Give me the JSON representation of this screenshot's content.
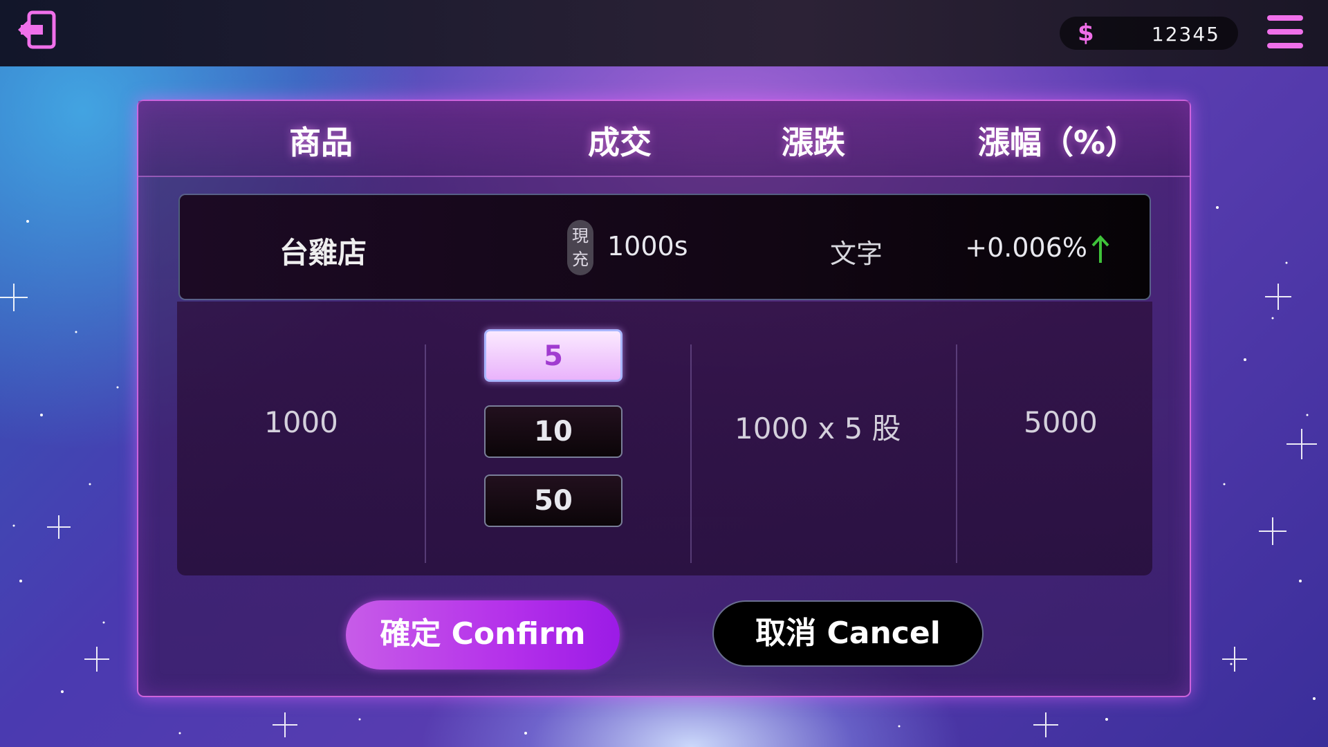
{
  "topbar": {
    "back_icon": "exit-door-icon",
    "currency_icon": "$",
    "balance": "12345",
    "menu_icon": "hamburger-menu-icon"
  },
  "table": {
    "headers": [
      "商品",
      "成交",
      "漲跌",
      "漲幅（%）"
    ],
    "stock": {
      "name": "台雞店",
      "tag_line1": "現",
      "tag_line2": "充",
      "price": "1000s",
      "change": "文字",
      "percent": "+0.006%",
      "trend_icon": "arrow-up-icon"
    }
  },
  "order": {
    "unit_price": "1000",
    "quantity_options": [
      "5",
      "10",
      "50"
    ],
    "selected_quantity": "5",
    "formula": "1000  x  5  股",
    "total": "5000"
  },
  "buttons": {
    "confirm": "確定 Confirm",
    "cancel": "取消 Cancel"
  },
  "colors": {
    "accent": "#f070ea",
    "trend_up": "#3fc23a",
    "confirm": "#b430ea"
  }
}
